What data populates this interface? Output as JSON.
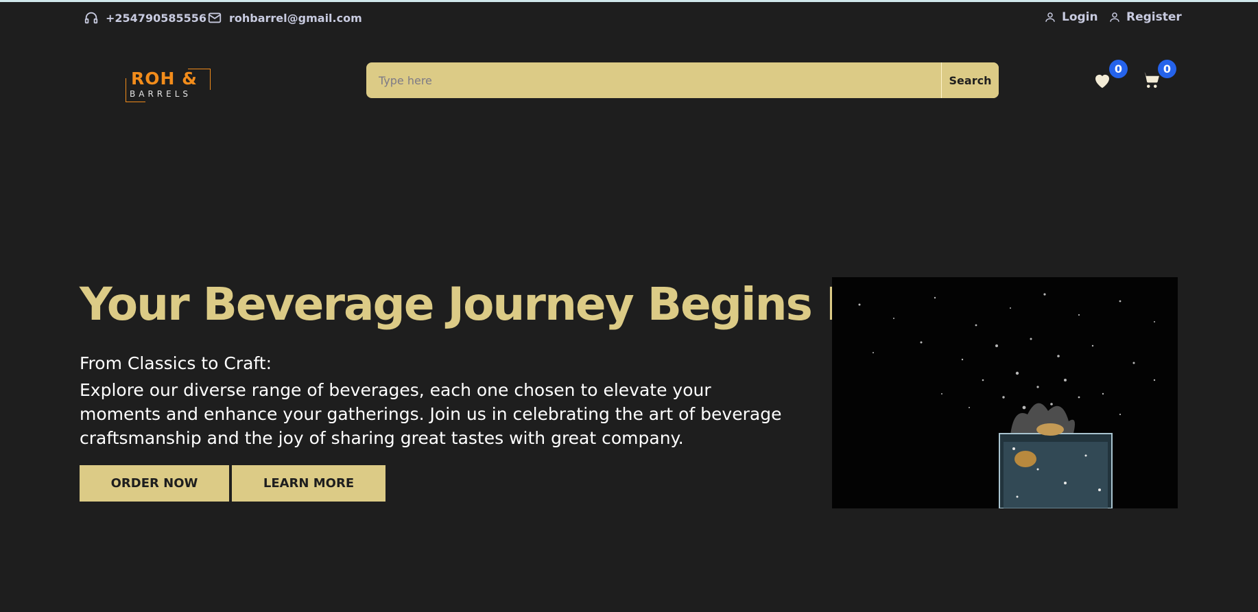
{
  "topbar": {
    "phone": "+254790585556",
    "email": "rohbarrel@gmail.com",
    "login_label": "Login",
    "register_label": "Register",
    "accent_color": "#cfe7ea",
    "text_color": "#c8cbe0"
  },
  "header": {
    "logo": {
      "line1": "ROH &",
      "line2": "BARRELS",
      "color": "#f28c1b"
    },
    "search": {
      "placeholder": "Type here",
      "button_label": "Search"
    },
    "wishlist_count": "0",
    "cart_count": "0",
    "badge_color": "#2563eb"
  },
  "hero": {
    "title": "Your Beverage Journey Begins Here",
    "subtitle": "From Classics to Craft:",
    "text": "Explore our diverse range of beverages, each one chosen to elevate your moments and enhance your gatherings. Join us in celebrating the art of beverage craftsmanship and the joy of sharing great tastes with great company.",
    "primary_button": "ORDER NOW",
    "secondary_button": "LEARN MORE",
    "image": "glass-splash-photo",
    "accent_color": "#dccb86",
    "background_color": "#1e1e1e"
  }
}
